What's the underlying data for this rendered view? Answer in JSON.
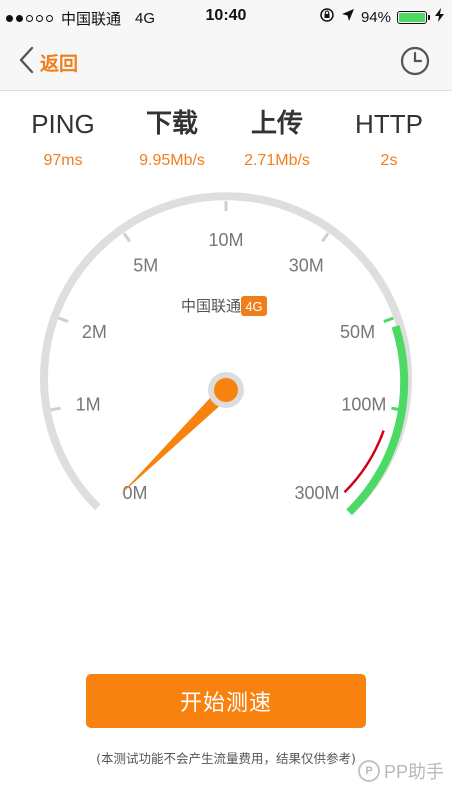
{
  "status_bar": {
    "carrier": "中国联通",
    "network": "4G",
    "time": "10:40",
    "battery_percent": "94%",
    "signal_bars_filled": 2,
    "signal_bars_total": 5,
    "icons": [
      "rotation-lock-icon",
      "location-arrow-icon",
      "battery-icon",
      "charging-bolt-icon"
    ]
  },
  "navbar": {
    "back_label": "返回",
    "icons": {
      "back": "chevron-left-icon",
      "history": "clock-icon"
    }
  },
  "stats": [
    {
      "label": "PING",
      "value": "97ms"
    },
    {
      "label": "下载",
      "value": "9.95Mb/s"
    },
    {
      "label": "上传",
      "value": "2.71Mb/s"
    },
    {
      "label": "HTTP",
      "value": "2s"
    }
  ],
  "gauge": {
    "ticks": [
      "0M",
      "1M",
      "2M",
      "5M",
      "10M",
      "30M",
      "50M",
      "100M",
      "300M"
    ],
    "carrier_label": "中国联通",
    "network_badge": "4G",
    "needle_value": "0M"
  },
  "actions": {
    "start_label": "开始测速"
  },
  "disclaimer": "(本测试功能不会产生流量费用，结果仅供参考)",
  "watermark": {
    "text": "PP助手"
  },
  "colors": {
    "accent": "#f07e1a",
    "button": "#f7820f",
    "gauge_track": "#dedede",
    "gauge_green": "#4cd964",
    "gauge_red": "#d0021b"
  }
}
